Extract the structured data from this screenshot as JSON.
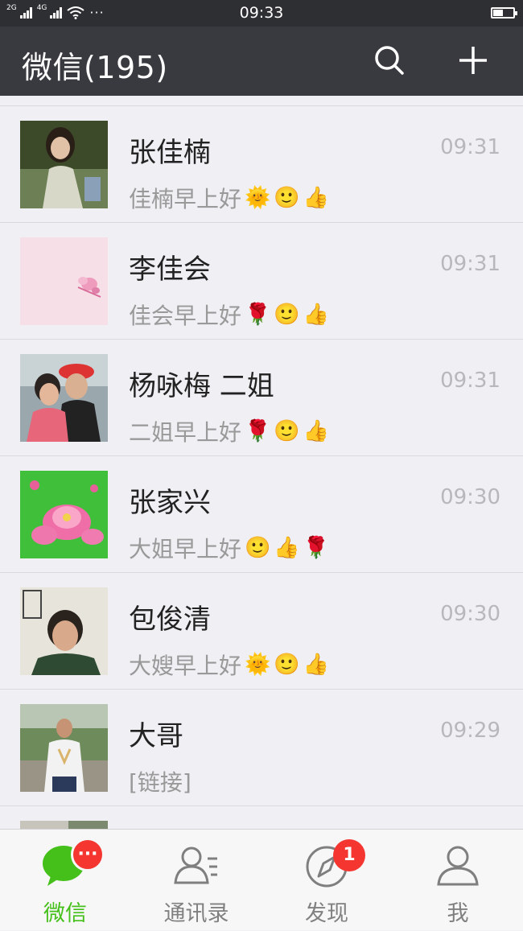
{
  "status_bar": {
    "network_2g": "2G",
    "network_4g": "4G",
    "time": "09:33",
    "more": "···"
  },
  "header": {
    "title": "微信(195)",
    "search_icon": "search-icon",
    "add_icon": "plus-icon"
  },
  "chats": [
    {
      "name": "张佳楠",
      "preview": "佳楠早上好",
      "emojis": [
        "🌞",
        "🙂",
        "👍"
      ],
      "time": "09:31"
    },
    {
      "name": "李佳会",
      "preview": "佳会早上好",
      "emojis": [
        "🌹",
        "🙂",
        "👍"
      ],
      "time": "09:31"
    },
    {
      "name": "杨咏梅 二姐",
      "preview": "二姐早上好",
      "emojis": [
        "🌹",
        "🙂",
        "👍"
      ],
      "time": "09:31"
    },
    {
      "name": "张家兴",
      "preview": "大姐早上好",
      "emojis": [
        "🙂",
        "👍",
        "🌹"
      ],
      "time": "09:30"
    },
    {
      "name": "包俊清",
      "preview": "大嫂早上好",
      "emojis": [
        "🌞",
        "🙂",
        "👍"
      ],
      "time": "09:30"
    },
    {
      "name": "大哥",
      "preview": "[链接]",
      "emojis": [],
      "time": "09:29"
    }
  ],
  "tabs": [
    {
      "label": "微信",
      "icon": "chat-bubble-icon",
      "badge": "···",
      "active": true
    },
    {
      "label": "通讯录",
      "icon": "contacts-icon",
      "badge": "",
      "active": false
    },
    {
      "label": "发现",
      "icon": "compass-icon",
      "badge": "1",
      "active": false
    },
    {
      "label": "我",
      "icon": "person-icon",
      "badge": "",
      "active": false
    }
  ],
  "colors": {
    "header_bg": "#393a3f",
    "accent_green": "#45c01a",
    "badge_red": "#f43530",
    "list_bg": "#efeff4"
  }
}
